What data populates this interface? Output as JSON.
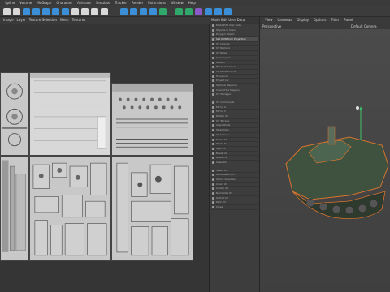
{
  "menubar": [
    "Spline",
    "Volume",
    "MoGraph",
    "Character",
    "Animate",
    "Simulate",
    "Tracker",
    "Render",
    "Extensions",
    "Window",
    "Help"
  ],
  "toolbar": {
    "icons": [
      "undo-icon",
      "redo-icon",
      "select-icon",
      "move-icon",
      "scale-icon",
      "rotate-icon",
      "object-icon",
      "x-axis-icon",
      "y-axis-icon",
      "z-axis-icon",
      "world-icon",
      "render-view-icon",
      "render-picture-icon",
      "render-settings-icon",
      "cube-icon",
      "pen-icon",
      "subdivision-icon",
      "cloner-icon",
      "deformer-icon",
      "floor-icon",
      "camera-icon",
      "light-icon"
    ],
    "colors": {
      "accent": "#3a8fd8",
      "green": "#2fa86a",
      "purple": "#8a5ac8",
      "axis": "#d9d9d9"
    }
  },
  "uv_editor": {
    "menu": [
      "Image",
      "Layer",
      "Texture Selection",
      "Mesh",
      "Textures"
    ]
  },
  "object_panel": {
    "header": "Mode Edit User Data",
    "items": [
      "Mode  Edit  User Data",
      "Objects in Scene",
      "Polygon Object",
      "Set UVW from Projection",
      "UV Unwrap",
      "UV Packing",
      "UV Relax",
      "Grid Layout",
      "Realign",
      "Fit UV to Canvas",
      "Fit Canvas to UV",
      "Transform",
      "Project UV",
      "Optimal Mapping",
      "Interactive Mapping",
      "UV Manager",
      "UV Commands",
      "Mirror U",
      "Mirror V",
      "Rotate UV",
      "UV Terrace",
      "Align Shells",
      "Straighten",
      "UV Islands",
      "Snap UV",
      "Weld UV",
      "Split UV",
      "Break UV",
      "Relax UV",
      "Scale UV",
      "Select All",
      "Grow Selection",
      "Shrink Selection",
      "Invert UV",
      "Center UV",
      "Normalize UV",
      "Unfold UV",
      "Pack UV",
      "Close"
    ],
    "highlighted_index": 3
  },
  "viewport": {
    "menu": [
      "View",
      "Cameras",
      "Display",
      "Options",
      "Filter",
      "Panel"
    ],
    "title": "Perspective",
    "camera": "Default Camera"
  }
}
